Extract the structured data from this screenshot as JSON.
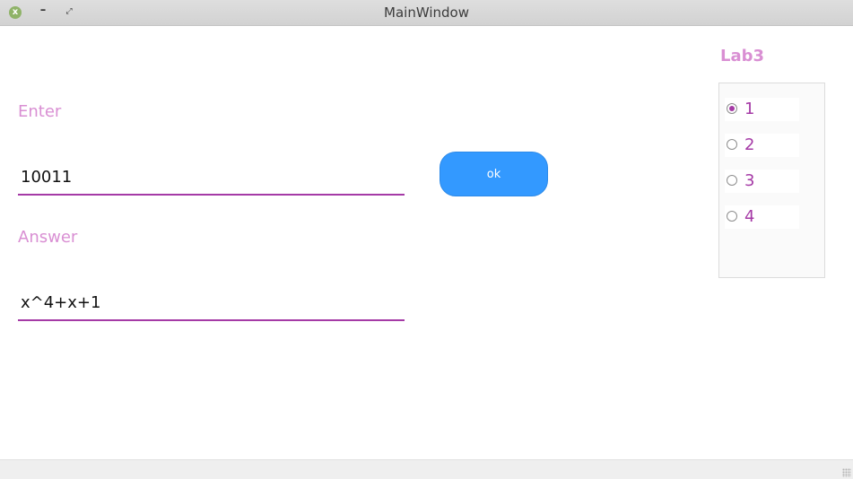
{
  "window": {
    "title": "MainWindow",
    "close_icon": "x",
    "minimize_icon": "–",
    "maximize_icon": "⤢"
  },
  "form": {
    "enter_label": "Enter",
    "enter_value": "10011",
    "answer_label": "Answer",
    "answer_value": "x^4+x+1",
    "ok_label": "ok"
  },
  "group": {
    "title": "Lab3",
    "options": [
      {
        "label": "1",
        "checked": true
      },
      {
        "label": "2",
        "checked": false
      },
      {
        "label": "3",
        "checked": false
      },
      {
        "label": "4",
        "checked": false
      }
    ]
  },
  "colors": {
    "accent": "#a53aa6",
    "label": "#d98fd3",
    "button": "#3399ff"
  }
}
